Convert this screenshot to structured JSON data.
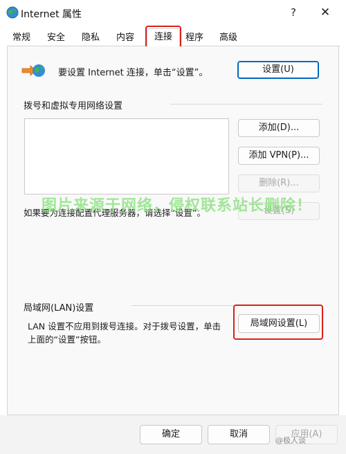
{
  "window": {
    "title": "Internet 属性",
    "help": "?",
    "close": "✕"
  },
  "tabs": [
    {
      "label": "常规"
    },
    {
      "label": "安全"
    },
    {
      "label": "隐私"
    },
    {
      "label": "内容"
    },
    {
      "label": "连接",
      "selected": true
    },
    {
      "label": "程序"
    },
    {
      "label": "高级"
    }
  ],
  "setup": {
    "text": "要设置 Internet 连接，单击“设置”。",
    "button": "设置(U)"
  },
  "dialup": {
    "heading": "拨号和虚拟专用网络设置",
    "add": "添加(D)...",
    "add_vpn": "添加 VPN(P)...",
    "remove": "删除(R)...",
    "settings": "设置(S)",
    "proxy_text": "如果要为连接配置代理服务器，请选择“设置”。"
  },
  "lan": {
    "heading": "局域网(LAN)设置",
    "text_line1": "LAN 设置不应用到拨号连接。对于拨号设置，单击",
    "text_line2": "上面的“设置”按钮。",
    "button": "局域网设置(L)"
  },
  "footer": {
    "ok": "确定",
    "cancel": "取消",
    "apply": "应用(A)"
  },
  "overlay": {
    "watermark": "图片来源于网络，侵权联系站长删除！",
    "source_mark": "@极人谈"
  },
  "colors": {
    "highlight_red": "#d9201a",
    "accent_blue": "#0067c0",
    "watermark_green": "#7fe072"
  }
}
